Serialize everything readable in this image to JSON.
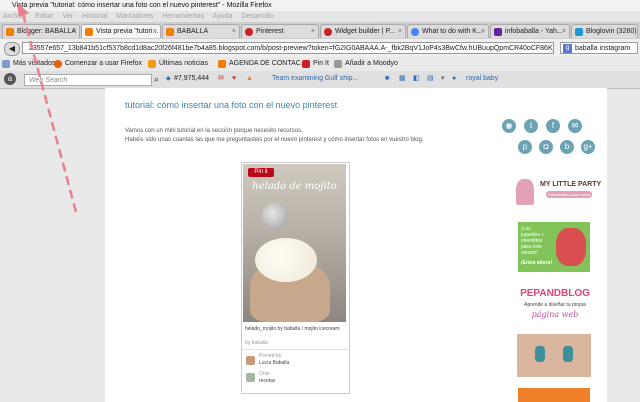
{
  "window": {
    "title": "Vista previa \"tutorial: cómo insertar una foto con el nuevo pinterest\" - Mozilla Firefox"
  },
  "menu": [
    "Archivo",
    "Editar",
    "Ver",
    "Historial",
    "Marcadores",
    "Herramientas",
    "Ayuda",
    "Desarrollo"
  ],
  "tabs": [
    {
      "label": "Blogger: BABALLA",
      "color": "#f57d00",
      "active": false
    },
    {
      "label": "Vista previa \"tutori...",
      "color": "#f57d00",
      "active": true
    },
    {
      "label": "BABALLA",
      "color": "#f57d00",
      "active": false
    },
    {
      "label": "Pinterest",
      "color": "#cb2027",
      "active": false
    },
    {
      "label": "Widget builder | P...",
      "color": "#cb2027",
      "active": false
    },
    {
      "label": "What to do with K...",
      "color": "#4285f4",
      "active": false
    },
    {
      "label": "infobaballa - Yah...",
      "color": "#5f259f",
      "active": false
    },
    {
      "label": "Bloglovin (3260)",
      "color": "#1a9ad6",
      "active": false
    }
  ],
  "nav": {
    "url": "23557e657_13b841b51cf537b8cd1d8ac20f26f481be7b4a85.blogspot.com/b/post-preview?token=fG2IG0ABAAA.A-_fbk2BqV1JoP4s3BwCfw.hUBuupQpmCR40oCF86KjiQ",
    "search_value": "baballa instagram"
  },
  "bookmarks": [
    {
      "label": "Más visitados",
      "color": "#7a9cc6"
    },
    {
      "label": "Comenzar a usar Firefox",
      "color": "#e66000"
    },
    {
      "label": "Últimas noticias",
      "color": "#f39c12"
    },
    {
      "label": "AGENDA DE CONTAC...",
      "color": "#f57d00"
    },
    {
      "label": "Pin It",
      "color": "#cb2027"
    },
    {
      "label": "Añadir a Moodyo",
      "color": "#888888"
    }
  ],
  "toolbar": {
    "search_placeholder": "Web Search",
    "count": "#7,975,444",
    "link": "Team examining Gulf ship...",
    "royal": "royal baby"
  },
  "post": {
    "title": "tutorial: cómo insertar una foto con el nuevo pinterest",
    "line1": "Vamos con un mini tutorial en la sección porque necesito recursos.",
    "line2": "Habéis sido unas cuantas las que me preguntasteis por el nuevo pinterest y cómo insertar fotos en vuestro blog."
  },
  "pin": {
    "button": "Pin it",
    "script": "helado de mojito",
    "caption": "helado_mojito by baballa / mojito icecream",
    "via": "by baballa",
    "pinned_by_label": "Pinned by",
    "pinned_by": "Lucía Baballa",
    "onto_label": "Onto",
    "onto": "recetas"
  },
  "sidebar": {
    "social_icons": [
      "rss-icon",
      "twitter-icon",
      "facebook-icon",
      "email-icon",
      "pinterest-icon",
      "instagram-icon",
      "bloglovin-icon",
      "googleplus-icon"
    ],
    "my_little_party": {
      "title": "MY LITTLE PARTY",
      "sub": "Cumpleaños para niños"
    },
    "ad1": {
      "text": "¡Los juguetes + divertidos para este verano!",
      "cta": "¡Entra ahora!"
    },
    "pepandblog": {
      "title": "PEPANDBLOG",
      "line1": "Aprende a diseñar tu propia",
      "line2": "página web"
    }
  },
  "colors": {
    "accent": "#3a86a9",
    "social": "#6ba3b5",
    "pinterest": "#bd081c",
    "annotation": "#e9828d"
  }
}
